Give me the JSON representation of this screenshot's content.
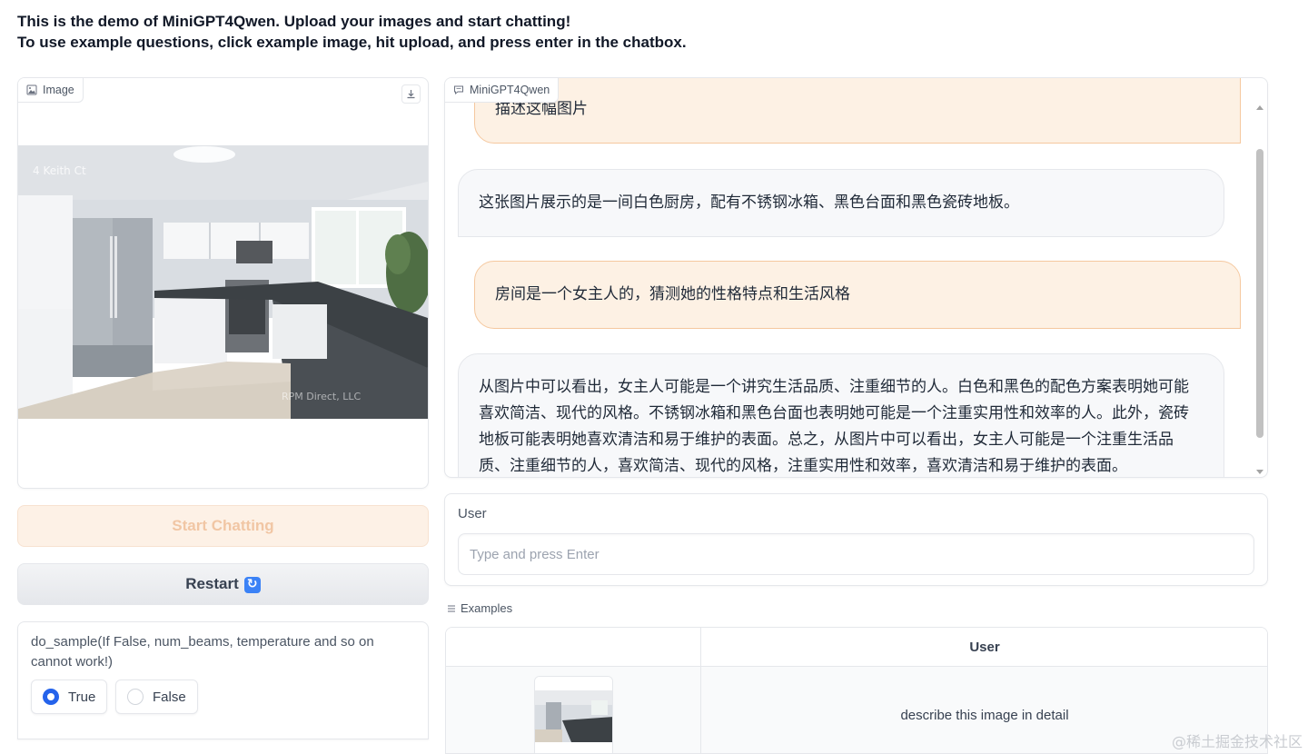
{
  "header": {
    "line1": "This is the demo of MiniGPT4Qwen. Upload your images and start chatting!",
    "line2": "To use example questions, click example image, hit upload, and press enter in the chatbox."
  },
  "image_panel": {
    "label": "Image",
    "download_icon": "download-icon",
    "photo_text": "4 Keith Ct",
    "photo_watermark": "RPM Direct, LLC"
  },
  "buttons": {
    "start_label": "Start Chatting",
    "restart_label": "Restart"
  },
  "do_sample": {
    "label": "do_sample(If False, num_beams, temperature and so on cannot work!)",
    "options": [
      "True",
      "False"
    ],
    "selected": "True"
  },
  "chatbot": {
    "label": "MiniGPT4Qwen",
    "messages": [
      {
        "role": "user",
        "text": "描述这幅图片"
      },
      {
        "role": "bot",
        "text": "这张图片展示的是一间白色厨房，配有不锈钢冰箱、黑色台面和黑色瓷砖地板。"
      },
      {
        "role": "user",
        "text": "房间是一个女主人的，猜测她的性格特点和生活风格"
      },
      {
        "role": "bot",
        "text": "从图片中可以看出，女主人可能是一个讲究生活品质、注重细节的人。白色和黑色的配色方案表明她可能喜欢简洁、现代的风格。不锈钢冰箱和黑色台面也表明她可能是一个注重实用性和效率的人。此外，瓷砖地板可能表明她喜欢清洁和易于维护的表面。总之，从图片中可以看出，女主人可能是一个注重生活品质、注重细节的人，喜欢简洁、现代的风格，注重实用性和效率，喜欢清洁和易于维护的表面。"
      }
    ]
  },
  "user_box": {
    "label": "User",
    "placeholder": "Type and press Enter",
    "value": ""
  },
  "examples": {
    "label": "Examples",
    "headers": [
      "",
      "User"
    ],
    "rows": [
      {
        "text": "describe this image in detail"
      }
    ]
  },
  "watermark": "@稀土掘金技术社区",
  "colors": {
    "accent": "#2563eb",
    "user_bubble_bg": "#fdf1e4",
    "user_bubble_border": "#f5c89f",
    "start_button_bg": "#fdf1e6",
    "start_button_text": "#f1c6a4"
  }
}
